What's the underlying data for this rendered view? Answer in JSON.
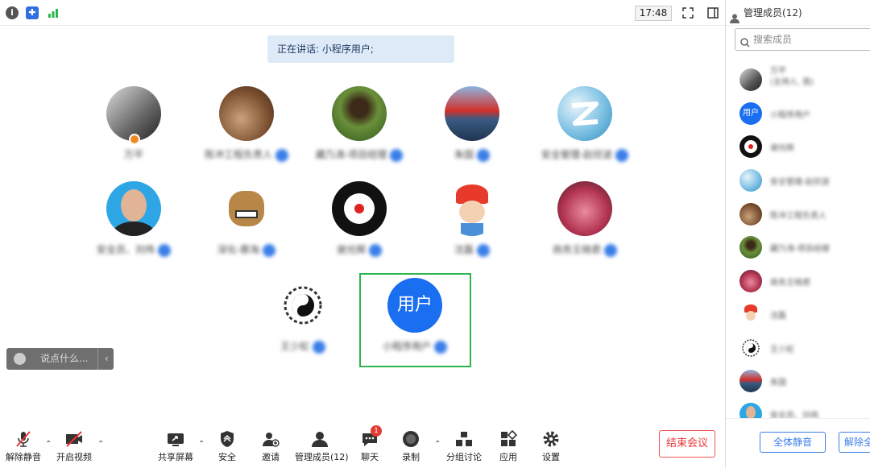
{
  "topbar": {
    "time": "17:48"
  },
  "speaking": {
    "label": "正在讲话: 小程序用户;"
  },
  "participants": [
    {
      "name": "万平"
    },
    {
      "name": "陈冲工程负责人"
    },
    {
      "name": "藏乃涛-项目经理"
    },
    {
      "name": "朱国"
    },
    {
      "name": "安全管理-赵欣波"
    },
    {
      "name": "安全员、刘伟"
    },
    {
      "name": "深化-蔡淘"
    },
    {
      "name": "谢光辉"
    },
    {
      "name": "沈磊"
    },
    {
      "name": "商务王晓君"
    },
    {
      "name": "王少虹"
    },
    {
      "name": "小程序用户",
      "avatar_text": "用户"
    }
  ],
  "chat": {
    "placeholder": "说点什么..."
  },
  "toolbar": {
    "unmute": "解除静音",
    "start_video": "开启视频",
    "share_screen": "共享屏幕",
    "security": "安全",
    "invite": "邀请",
    "manage_members": "管理成员(12)",
    "chat": "聊天",
    "chat_badge": "1",
    "record": "录制",
    "breakout": "分组讨论",
    "apps": "应用",
    "settings": "设置",
    "end_meeting": "结束会议"
  },
  "sidebar": {
    "title": "管理成员(12)",
    "search_placeholder": "搜索成员",
    "members": [
      {
        "name": "万平",
        "sub": "(主持人, 我)"
      },
      {
        "name": "小程序用户",
        "avatar_text": "用户"
      },
      {
        "name": "谢光辉"
      },
      {
        "name": "安全管理-赵欣波"
      },
      {
        "name": "陈冲工程负责人"
      },
      {
        "name": "藏乃涛-项目经理"
      },
      {
        "name": "商务王晓君"
      },
      {
        "name": "沈磊"
      },
      {
        "name": "王少虹"
      },
      {
        "name": "朱国"
      },
      {
        "name": "安全员、刘伟"
      }
    ],
    "mute_all": "全体静音",
    "unmute_all": "解除全"
  },
  "colors": {
    "accent": "#3a7ee8",
    "end": "#e33333",
    "selected_border": "#2ab64e"
  }
}
